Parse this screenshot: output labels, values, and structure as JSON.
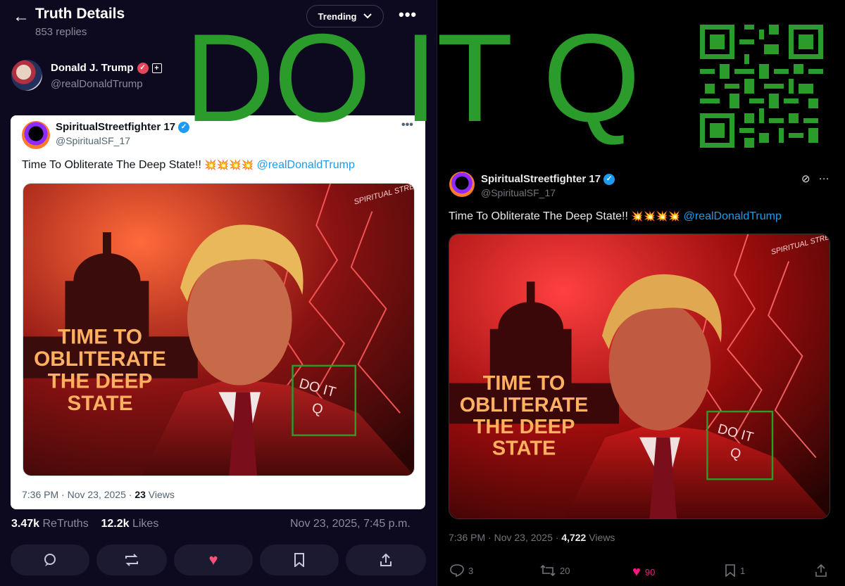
{
  "left": {
    "header": {
      "title": "Truth Details",
      "subtitle": "853 replies",
      "trend_label": "Trending",
      "back_icon": "arrow-left-icon"
    },
    "author": {
      "name": "Donald J. Trump",
      "handle": "@realDonaldTrump"
    },
    "card": {
      "name": "SpiritualStreetfighter 17",
      "handle": "@SpiritualSF_17",
      "text": "Time To Obliterate The Deep State!!",
      "emojis": "💥💥💥💥",
      "mention": "@realDonaldTrump",
      "time": "7:36 PM · Nov 23, 2025 · ",
      "views_count": "23",
      "views_label": " Views"
    },
    "stats": {
      "retruths_count": "3.47k",
      "retruths_label": " ReTruths",
      "likes_count": "12.2k",
      "likes_label": " Likes",
      "posted": "Nov 23, 2025, 7:45 p.m."
    }
  },
  "image": {
    "title_lines": [
      "TIME TO",
      "OBLITERATE",
      "THE DEEP",
      "STATE"
    ],
    "signature_text": "SPIRITUAL STREETFIGHTER",
    "box_text": [
      "DO IT",
      "Q"
    ]
  },
  "overlay": {
    "text": "DO IT Q",
    "color": "#2b9b2b"
  },
  "right": {
    "name": "SpiritualStreetfighter 17",
    "handle": "@SpiritualSF_17",
    "text": "Time To Obliterate The Deep State!!",
    "emojis": "💥💥💥💥",
    "mention": "@realDonaldTrump",
    "time": "7:36 PM · Nov 23, 2025 · ",
    "views_count": "4,722",
    "views_label": " Views",
    "replies": "3",
    "reposts": "20",
    "likes": "90",
    "bookmarks": "1"
  },
  "colors": {
    "truth_bg": "#0d0a1f",
    "x_bg": "#000000",
    "link_blue": "#1d9bf0",
    "like_pink": "#f91880",
    "truth_heart": "#ff4f7b"
  }
}
